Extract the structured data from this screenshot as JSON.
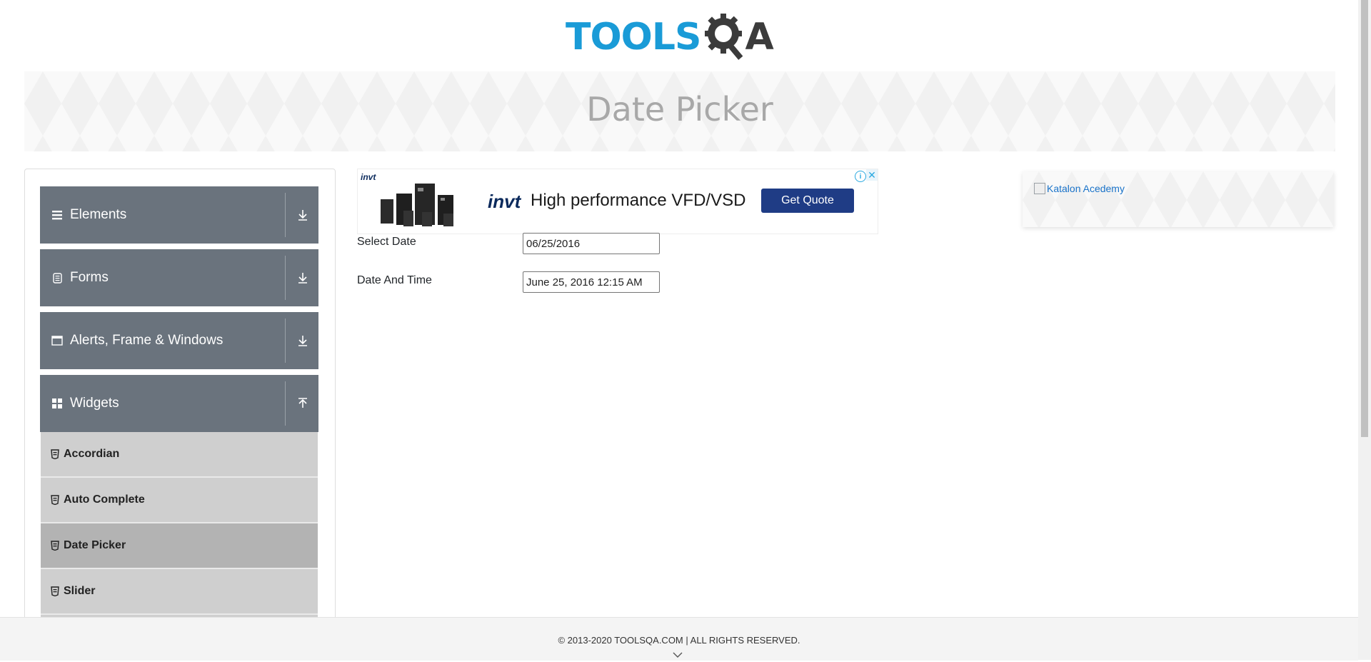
{
  "header": {
    "logo_text_main": "TOOLS",
    "logo_text_end": "A",
    "logo_alt": "TOOLSQA"
  },
  "banner": {
    "title": "Date Picker"
  },
  "sidebar": {
    "groups": [
      {
        "label": "Elements",
        "icon": "list-icon",
        "state": "collapsed"
      },
      {
        "label": "Forms",
        "icon": "form-icon",
        "state": "collapsed"
      },
      {
        "label": "Alerts, Frame & Windows",
        "icon": "window-icon",
        "state": "collapsed"
      },
      {
        "label": "Widgets",
        "icon": "widgets-icon",
        "state": "expanded"
      }
    ],
    "widget_items": [
      {
        "label": "Accordian",
        "active": false
      },
      {
        "label": "Auto Complete",
        "active": false
      },
      {
        "label": "Date Picker",
        "active": true
      },
      {
        "label": "Slider",
        "active": false
      }
    ]
  },
  "ad": {
    "brand_small": "invt",
    "brand": "invt",
    "text": "High performance VFD/VSD",
    "button": "Get Quote"
  },
  "form": {
    "select_date_label": "Select Date",
    "select_date_value": "06/25/2016",
    "date_time_label": "Date And Time",
    "date_time_value": "June 25, 2016 12:15 AM"
  },
  "right_ad": {
    "alt_text": "Katalon Acedemy"
  },
  "footer": {
    "text": "© 2013-2020 TOOLSQA.COM | ALL RIGHTS RESERVED."
  },
  "colors": {
    "logo_blue": "#1a9bd7",
    "sidebar_group": "#6a737d",
    "sidebar_item": "#cfcfcf",
    "sidebar_item_active": "#b3b3b3",
    "ad_button": "#1f3c85"
  }
}
